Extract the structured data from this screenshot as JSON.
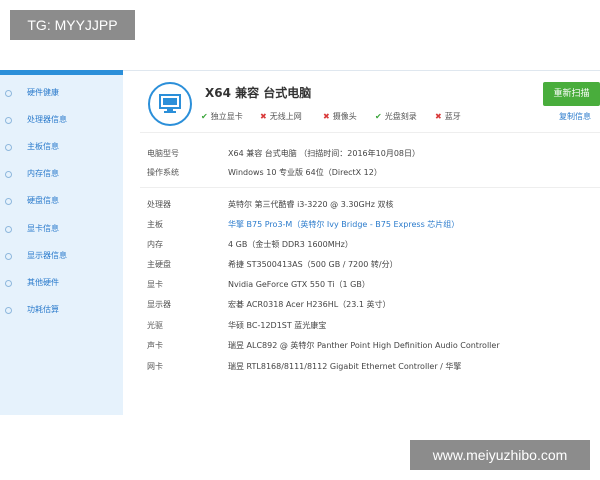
{
  "overlay": {
    "top_left": "TG: MYYJJPP",
    "bottom_right": "www.meiyuzhibo.com"
  },
  "sidebar": {
    "items": [
      {
        "label": "硬件健康"
      },
      {
        "label": "处理器信息"
      },
      {
        "label": "主板信息"
      },
      {
        "label": "内存信息"
      },
      {
        "label": "硬盘信息"
      },
      {
        "label": "显卡信息"
      },
      {
        "label": "显示器信息"
      },
      {
        "label": "其他硬件"
      },
      {
        "label": "功耗估算"
      }
    ]
  },
  "header": {
    "title": "X64 兼容 台式电脑",
    "features": [
      {
        "label": "独立显卡",
        "status": "yes"
      },
      {
        "label": "无线上网",
        "status": "no"
      },
      {
        "label": "摄像头",
        "status": "no"
      },
      {
        "label": "光盘刻录",
        "status": "yes"
      },
      {
        "label": "蓝牙",
        "status": "no"
      }
    ],
    "scan_button": "重新扫描",
    "copy_link": "复制信息"
  },
  "summary": [
    {
      "key": "电脑型号",
      "value": "X64 兼容 台式电脑 （扫描时间：2016年10月08日）"
    },
    {
      "key": "操作系统",
      "value": "Windows 10 专业版 64位（DirectX 12）"
    }
  ],
  "specs": [
    {
      "key": "处理器",
      "value": "英特尔 第三代酷睿 i3-3220 @ 3.30GHz 双核",
      "link": false
    },
    {
      "key": "主板",
      "value": "华擎 B75 Pro3-M（英特尔 Ivy Bridge - B75 Express 芯片组）",
      "link": true
    },
    {
      "key": "内存",
      "value": "4 GB（金士顿 DDR3 1600MHz）",
      "link": false
    },
    {
      "key": "主硬盘",
      "value": "希捷 ST3500413AS（500 GB / 7200 转/分）",
      "link": false
    },
    {
      "key": "显卡",
      "value": "Nvidia GeForce GTX 550 Ti（1 GB）",
      "link": false
    },
    {
      "key": "显示器",
      "value": "宏碁 ACR0318 Acer H236HL（23.1 英寸）",
      "link": false
    },
    {
      "key": "光驱",
      "value": "华硕 BC-12D1ST 蓝光康宝",
      "link": false
    },
    {
      "key": "声卡",
      "value": "瑞昱 ALC892 @ 英特尔 Panther Point High Definition Audio Controller",
      "link": false
    },
    {
      "key": "网卡",
      "value": "瑞昱 RTL8168/8111/8112 Gigabit Ethernet Controller / 华擎",
      "link": false
    }
  ],
  "colors": {
    "accent": "#2b8fd9",
    "sidebar_bg": "#e6f2fc",
    "scan_button": "#49ad3c",
    "ok": "#3aa53a",
    "no": "#d93a3a"
  }
}
